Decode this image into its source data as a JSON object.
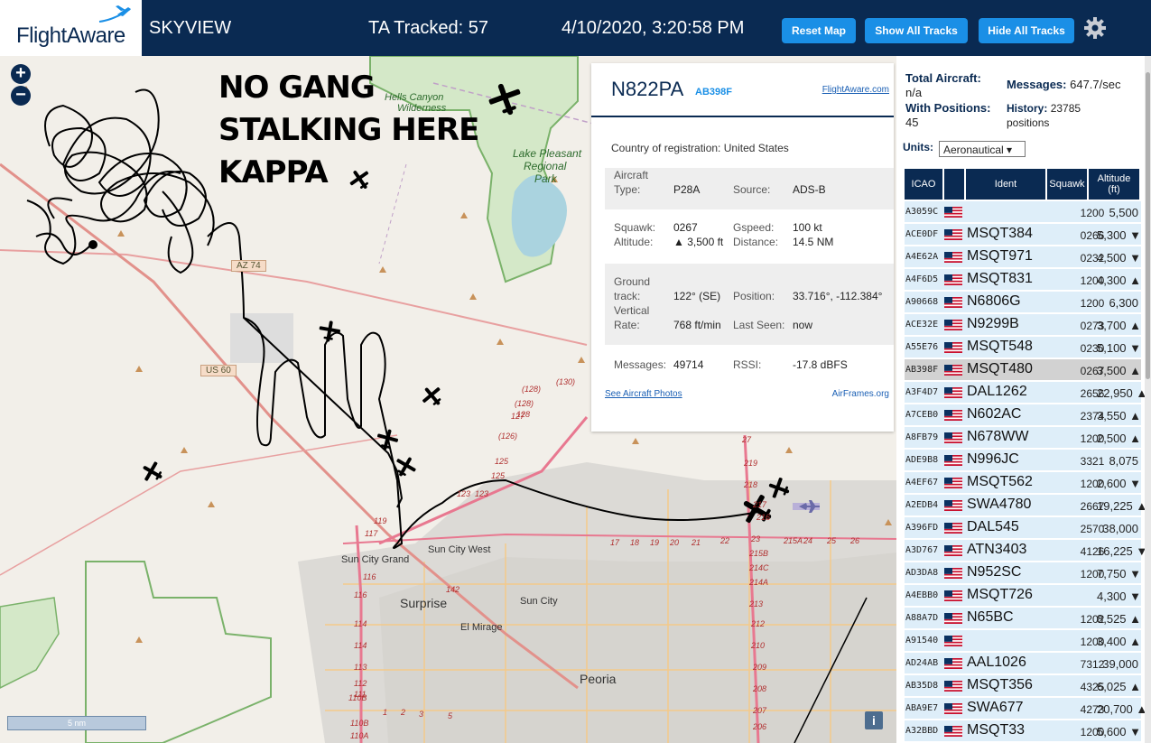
{
  "header": {
    "logo_text": "FlightAware",
    "title": "SKYVIEW",
    "tracked": "TA Tracked: 57",
    "datetime": "4/10/2020, 3:20:58 PM",
    "buttons": {
      "reset": "Reset Map",
      "show": "Show All Tracks",
      "hide": "Hide All Tracks"
    },
    "gear_icon": "gear-icon"
  },
  "map": {
    "zoom_in": "+",
    "zoom_out": "−",
    "scale": "5 nm",
    "info": "i",
    "overlay_text": [
      "NO GANG",
      "STALKING HERE",
      "KAPPA"
    ],
    "labels": {
      "hells_canyon": "Hells Canyon",
      "hells_canyon2": "Wilderness",
      "lake_pleasant": "Lake Pleasant",
      "regional": "Regional",
      "park": "Park",
      "sun_city_west": "Sun City West",
      "sun_city_grand": "Sun City Grand",
      "surprise": "Surprise",
      "sun_city": "Sun City",
      "el_mirage": "El Mirage",
      "peoria": "Peoria"
    },
    "shields": {
      "az74": "AZ 74",
      "us60": "US 60"
    },
    "route_numbers": [
      "(128)",
      "(130)",
      "(128)",
      "128",
      "127",
      "(126)",
      "125",
      "125",
      "123",
      "123",
      "119",
      "117",
      "116",
      "116",
      "114",
      "114",
      "113",
      "112",
      "111",
      "110B",
      "110B",
      "110A",
      "142",
      "17",
      "18",
      "19",
      "20",
      "21",
      "22",
      "23",
      "215A",
      "24",
      "25",
      "26",
      "27",
      "219",
      "218",
      "217",
      "216",
      "215B",
      "214C",
      "214A",
      "213",
      "212",
      "210",
      "209",
      "208",
      "207",
      "206",
      "1",
      "2",
      "3",
      "5",
      "7"
    ]
  },
  "detail": {
    "registration": "N822PA",
    "icao": "AB398F",
    "flightaware_link": "FlightAware.com",
    "country_label": "Country of registration:",
    "country": "United States",
    "aircraft_type_label1": "Aircraft",
    "aircraft_type_label2": "Type:",
    "aircraft_type": "P28A",
    "source_label": "Source:",
    "source": "ADS-B",
    "squawk_label": "Squawk:",
    "squawk": "0267",
    "altitude_label": "Altitude:",
    "altitude": "▲ 3,500 ft",
    "gspeed_label": "Gspeed:",
    "gspeed": "100 kt",
    "distance_label": "Distance:",
    "distance": "14.5 NM",
    "ground_label1": "Ground",
    "ground_label2": "track:",
    "ground_track": "122° (SE)",
    "vertical_label1": "Vertical",
    "vertical_label2": "Rate:",
    "vertical_rate": "768 ft/min",
    "position_label": "Position:",
    "position": "33.716°, -112.384°",
    "last_seen_label": "Last Seen:",
    "last_seen": "now",
    "messages_label": "Messages:",
    "messages": "49714",
    "rssi_label": "RSSI:",
    "rssi": "-17.8 dBFS",
    "photos_link": "See Aircraft Photos",
    "airframes_link": "AirFrames.org"
  },
  "sidebar": {
    "total_label": "Total Aircraft:",
    "total": "n/a",
    "positions_label": "With Positions:",
    "positions": "45",
    "messages_label": "Messages:",
    "messages": "647.7/sec",
    "history_label": "History:",
    "history": "23785 positions",
    "units_label": "Units:",
    "units_value": "Aeronautical ▾",
    "columns": {
      "icao": "ICAO",
      "ident": "Ident",
      "squawk": "Squawk",
      "alt1": "Altitude",
      "alt2": "(ft)"
    },
    "rows": [
      {
        "icao": "A3059C",
        "ident": "",
        "squawk": "1200",
        "alt": "5,500"
      },
      {
        "icao": "ACE0DF",
        "ident": "MSQT384",
        "squawk": "0266",
        "alt": "5,300 ▼"
      },
      {
        "icao": "A4E62A",
        "ident": "MSQT971",
        "squawk": "0232",
        "alt": "4,500 ▼"
      },
      {
        "icao": "A4F6D5",
        "ident": "MSQT831",
        "squawk": "1200",
        "alt": "4,300 ▲"
      },
      {
        "icao": "A90668",
        "ident": "N6806G",
        "squawk": "1200",
        "alt": "6,300"
      },
      {
        "icao": "ACE32E",
        "ident": "N9299B",
        "squawk": "0273",
        "alt": "3,700 ▲"
      },
      {
        "icao": "A55E76",
        "ident": "MSQT548",
        "squawk": "0230",
        "alt": "5,100 ▼"
      },
      {
        "icao": "AB398F",
        "ident": "MSQT480",
        "squawk": "0267",
        "alt": "3,500 ▲"
      },
      {
        "icao": "A3F4D7",
        "ident": "DAL1262",
        "squawk": "2656",
        "alt": "22,950 ▲"
      },
      {
        "icao": "A7CEB0",
        "ident": "N602AC",
        "squawk": "2374",
        "alt": "3,550 ▲"
      },
      {
        "icao": "A8FB79",
        "ident": "N678WW",
        "squawk": "1200",
        "alt": "2,500 ▲"
      },
      {
        "icao": "ADE9B8",
        "ident": "N996JC",
        "squawk": "3321",
        "alt": "8,075"
      },
      {
        "icao": "A4EF67",
        "ident": "MSQT562",
        "squawk": "1200",
        "alt": "2,600 ▼"
      },
      {
        "icao": "A2EDB4",
        "ident": "SWA4780",
        "squawk": "2667",
        "alt": "19,225 ▲"
      },
      {
        "icao": "A396FD",
        "ident": "DAL545",
        "squawk": "2570",
        "alt": "38,000"
      },
      {
        "icao": "A3D767",
        "ident": "ATN3403",
        "squawk": "4126",
        "alt": "16,225 ▼"
      },
      {
        "icao": "AD3DA8",
        "ident": "N952SC",
        "squawk": "1200",
        "alt": "7,750 ▼"
      },
      {
        "icao": "A4EBB0",
        "ident": "MSQT726",
        "squawk": "",
        "alt": "4,300 ▼"
      },
      {
        "icao": "A88A7D",
        "ident": "N65BC",
        "squawk": "1202",
        "alt": "8,525 ▲"
      },
      {
        "icao": "A91540",
        "ident": "",
        "squawk": "1200",
        "alt": "3,400 ▲"
      },
      {
        "icao": "AD24AB",
        "ident": "AAL1026",
        "squawk": "7312",
        "alt": "39,000"
      },
      {
        "icao": "AB35D8",
        "ident": "MSQT356",
        "squawk": "4325",
        "alt": "6,025 ▲"
      },
      {
        "icao": "ABA9E7",
        "ident": "SWA677",
        "squawk": "4273",
        "alt": "20,700 ▲"
      },
      {
        "icao": "A32BBD",
        "ident": "MSQT33",
        "squawk": "1200",
        "alt": "5,600 ▼"
      }
    ]
  }
}
